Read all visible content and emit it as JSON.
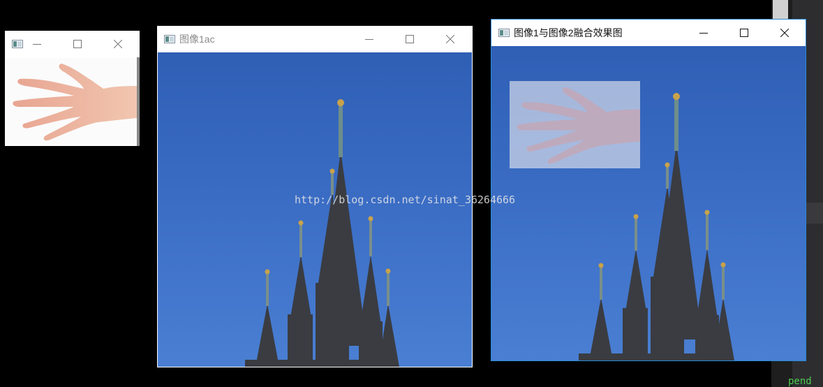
{
  "windows": {
    "hand": {
      "title": ""
    },
    "cathedral": {
      "title": "图像1ac"
    },
    "blend": {
      "title": "图像1与图像2融合效果图"
    }
  },
  "watermark": "http://blog.csdn.net/sinat_36264666",
  "background_code_fragment": "pend",
  "colors": {
    "sky": "#3a6cc4",
    "desktop": "#000000",
    "active_border": "#2a8ad4"
  },
  "icons": {
    "app": "opencv-window-icon",
    "minimize": "minimize-icon",
    "maximize": "maximize-icon",
    "close": "close-icon"
  }
}
